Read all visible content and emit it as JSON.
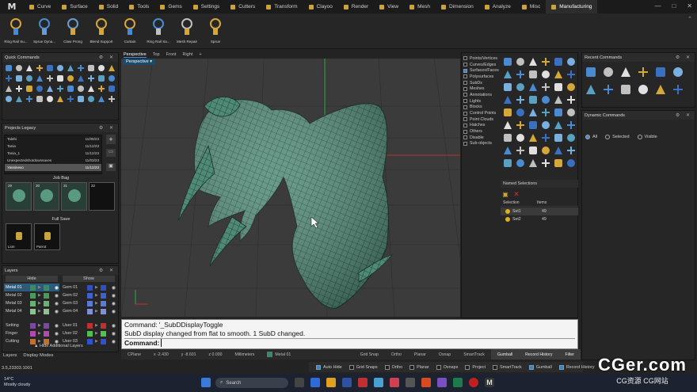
{
  "app": {
    "logo": "M",
    "tabs": [
      {
        "label": "Curve",
        "color": "#c9a43a"
      },
      {
        "label": "Surface",
        "color": "#c9a43a"
      },
      {
        "label": "Solid",
        "color": "#c9a43a"
      },
      {
        "label": "Tools",
        "color": "#c9a43a"
      },
      {
        "label": "Gems",
        "color": "#c9a43a"
      },
      {
        "label": "Settings",
        "color": "#c9a43a"
      },
      {
        "label": "Cutters",
        "color": "#c9a43a"
      },
      {
        "label": "Transform",
        "color": "#c9a43a"
      },
      {
        "label": "Clayoo",
        "color": "#c9a43a"
      },
      {
        "label": "Render",
        "color": "#c9a43a"
      },
      {
        "label": "View",
        "color": "#c9a43a"
      },
      {
        "label": "Mesh",
        "color": "#c9a43a"
      },
      {
        "label": "Dimension",
        "color": "#c9a43a"
      },
      {
        "label": "Analyze",
        "color": "#c9a43a"
      },
      {
        "label": "Misc",
        "color": "#c9a43a"
      },
      {
        "label": "Manufacturing",
        "color": "#c9a43a"
      }
    ],
    "window": {
      "minimize": "—",
      "maximize": "□",
      "close": "✕"
    }
  },
  "ribbon": [
    {
      "label": "Ring Rail Su...",
      "icon": "ring-rail-icon"
    },
    {
      "label": "Sprue Dyna...",
      "icon": "sprue-icon"
    },
    {
      "label": "Claw Prong",
      "icon": "claw-prong-icon"
    },
    {
      "label": "Blend Support",
      "icon": "support-icon"
    },
    {
      "label": "Curtain",
      "icon": "curtain-icon"
    },
    {
      "label": "Ring Rail Sa...",
      "icon": "ring-rail-icon"
    },
    {
      "label": "Mesh Repair",
      "icon": "mesh-repair-icon"
    },
    {
      "label": "Sprue",
      "icon": "sprue-icon"
    }
  ],
  "quick_commands": {
    "title": "Quick Commands"
  },
  "projects": {
    "title": "Projects Legacy",
    "items": [
      {
        "name": "Talebi",
        "date": "11/09/23"
      },
      {
        "name": "Tania",
        "date": "11/12/23"
      },
      {
        "name": "Tania_1",
        "date": "11/12/23"
      },
      {
        "name": "Unexpectedshotdownsaves",
        "date": "11/03/23"
      },
      {
        "name": "Yassinexo",
        "date": "11/12/23"
      }
    ],
    "job_bag": "Job Bag",
    "job_ids": [
      "29",
      "30",
      "31",
      "32"
    ],
    "full_save": "Full Save",
    "saves": [
      "Lion",
      "Parrot"
    ]
  },
  "layers": {
    "title": "Layers",
    "hide": "Hide",
    "show": "Show",
    "hide_additional": "Hide Additional Layers",
    "left": [
      {
        "name": "Metal 01",
        "color": "#3a8a6a",
        "selected": true
      },
      {
        "name": "Metal 02",
        "color": "#4a9a5a"
      },
      {
        "name": "Metal 03",
        "color": "#6ab070"
      },
      {
        "name": "Metal 04",
        "color": "#8fc08f"
      },
      {
        "name": "Setting",
        "color": "#7a4aa0"
      },
      {
        "name": "Finger",
        "color": "#b04ab0"
      },
      {
        "name": "Cutting",
        "color": "#c07030"
      }
    ],
    "right": [
      {
        "name": "Gem 01",
        "color": "#3050c0"
      },
      {
        "name": "Gem 02",
        "color": "#4060d0"
      },
      {
        "name": "Gem 03",
        "color": "#5a7ad8"
      },
      {
        "name": "Gem 04",
        "color": "#8090d8"
      },
      {
        "name": "User 01",
        "color": "#c03030"
      },
      {
        "name": "User 02",
        "color": "#50c050"
      },
      {
        "name": "User 03",
        "color": "#3050d0"
      }
    ],
    "bottom_tabs": [
      "Layers",
      "Display Modes"
    ]
  },
  "viewport": {
    "tabs": [
      "Perspective",
      "Top",
      "Front",
      "Right",
      "+"
    ],
    "label": "Perspective ▾"
  },
  "display_filter": [
    "Points/Vertices",
    "Curves/Edges",
    "Surfaces/Faces",
    "Polysurfaces",
    "SubDs",
    "Meshes",
    "Annotations",
    "Lights",
    "Blocks",
    "Control Points",
    "Point Clouds",
    "Hatches",
    "Others",
    "Disable",
    "Sub-objects"
  ],
  "display_filter_checked": [
    false,
    false,
    true,
    false,
    false,
    false,
    false,
    false,
    false,
    false,
    false,
    false,
    false,
    false,
    false
  ],
  "named_selections": {
    "title": "Named Selections",
    "col1": "Selection",
    "col2": "Items",
    "rows": [
      {
        "name": "Set1",
        "items": "49"
      },
      {
        "name": "Set2",
        "items": "49"
      }
    ]
  },
  "recent_commands": {
    "title": "Recent Commands"
  },
  "dynamic_commands": {
    "title": "Dynamic Commands",
    "options": [
      "All",
      "Selected",
      "Visible"
    ]
  },
  "command": {
    "line1": "Command: '_SubDDisplayToggle",
    "line2": "SubD display changed from flat to smooth. 1 SubD changed.",
    "prompt": "Command:"
  },
  "status": {
    "cplane": "CPlane",
    "x": "x -2.430",
    "y": "y -8.601",
    "z": "z 0.000",
    "units": "Millimeters",
    "layer": "Metal 01",
    "toggles": [
      "Grid Snap",
      "Ortho",
      "Planar",
      "Osnap",
      "SmartTrack",
      "Gumball",
      "Record History",
      "Filter"
    ]
  },
  "coords": "3.5,23303.1001",
  "osnap": [
    {
      "label": "Auto Hide",
      "on": true
    },
    {
      "label": "Grid Snaps",
      "on": false
    },
    {
      "label": "Ortho",
      "on": false
    },
    {
      "label": "Planar",
      "on": false
    },
    {
      "label": "Osnaps",
      "on": false
    },
    {
      "label": "Project",
      "on": false
    },
    {
      "label": "SmartTrack",
      "on": false
    },
    {
      "label": "Gumball",
      "on": true
    },
    {
      "label": "Record History",
      "on": true
    }
  ],
  "taskbar": {
    "temp": "14°C",
    "weather": "Mostly cloudy",
    "search": "Search"
  },
  "watermark": {
    "main": "CGer.com",
    "sub": "CG资源 CG网站"
  }
}
